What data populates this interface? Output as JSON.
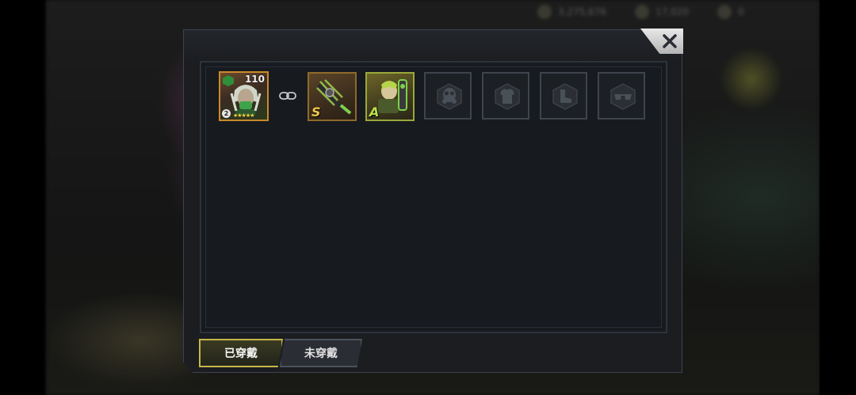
{
  "top_resources": [
    {
      "icon": "coin-icon",
      "value": "3,275,676"
    },
    {
      "icon": "gear-resource-icon",
      "value": "17,020"
    },
    {
      "icon": "gem-icon",
      "value": "0"
    }
  ],
  "hero": {
    "level": "110",
    "rank": "2",
    "stars": "★★★★★",
    "faction_icon": "faction-icon",
    "border_color": "#c98a2a"
  },
  "equipment": [
    {
      "name": "weapon",
      "grade": "S",
      "icon": "claw-weapon-icon"
    },
    {
      "name": "armor",
      "grade": "A",
      "icon": "mechanic-arm-icon"
    }
  ],
  "empty_slots": [
    {
      "icon": "gas-mask-icon"
    },
    {
      "icon": "body-armor-icon"
    },
    {
      "icon": "boots-icon"
    },
    {
      "icon": "goggles-icon"
    }
  ],
  "tabs": [
    {
      "label": "已穿戴",
      "active": true
    },
    {
      "label": "未穿戴",
      "active": false
    }
  ],
  "colors": {
    "accent_gold": "#c8b64a",
    "grade_s": "#f0c84a",
    "grade_a": "#b9e04a"
  }
}
